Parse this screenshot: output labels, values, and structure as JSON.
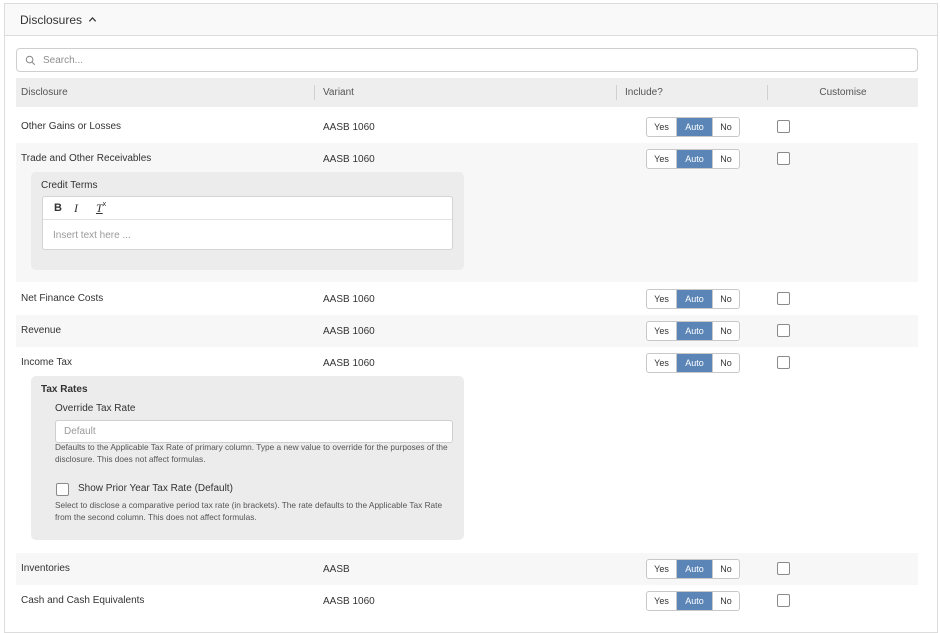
{
  "section": {
    "title": "Disclosures"
  },
  "search": {
    "placeholder": "Search..."
  },
  "columns": {
    "disclosure": "Disclosure",
    "variant": "Variant",
    "include": "Include?",
    "customise": "Customise"
  },
  "toggle": {
    "yes": "Yes",
    "auto": "Auto",
    "no": "No",
    "selected": "Auto"
  },
  "rows": [
    {
      "name": "Other Gains or Losses",
      "variant": "AASB 1060"
    },
    {
      "name": "Trade and Other Receivables",
      "variant": "AASB 1060"
    },
    {
      "name": "Net Finance Costs",
      "variant": "AASB 1060"
    },
    {
      "name": "Revenue",
      "variant": "AASB 1060"
    },
    {
      "name": "Income Tax",
      "variant": "AASB 1060"
    },
    {
      "name": "Inventories",
      "variant": "AASB"
    },
    {
      "name": "Cash and Cash Equivalents",
      "variant": "AASB 1060"
    }
  ],
  "credit_terms": {
    "label": "Credit Terms",
    "toolbar": {
      "bold": "B",
      "italic": "I",
      "clear": "T",
      "clear_sub": "x"
    },
    "placeholder": "Insert text here ..."
  },
  "tax_rates": {
    "title": "Tax Rates",
    "override_label": "Override Tax Rate",
    "override_placeholder": "Default",
    "override_help": "Defaults to the Applicable Tax Rate of primary column. Type a new value to override for the purposes of the disclosure. This does not affect formulas.",
    "prior_label": "Show Prior Year Tax Rate",
    "prior_default": "(Default)",
    "prior_help": "Select to disclose a comparative period tax rate (in brackets). The rate defaults to the Applicable Tax Rate from the second column. This does not affect formulas."
  },
  "colors": {
    "accent": "#5a85b6",
    "header_bg": "#eeeeee",
    "row_shade": "#f7f7f7"
  }
}
